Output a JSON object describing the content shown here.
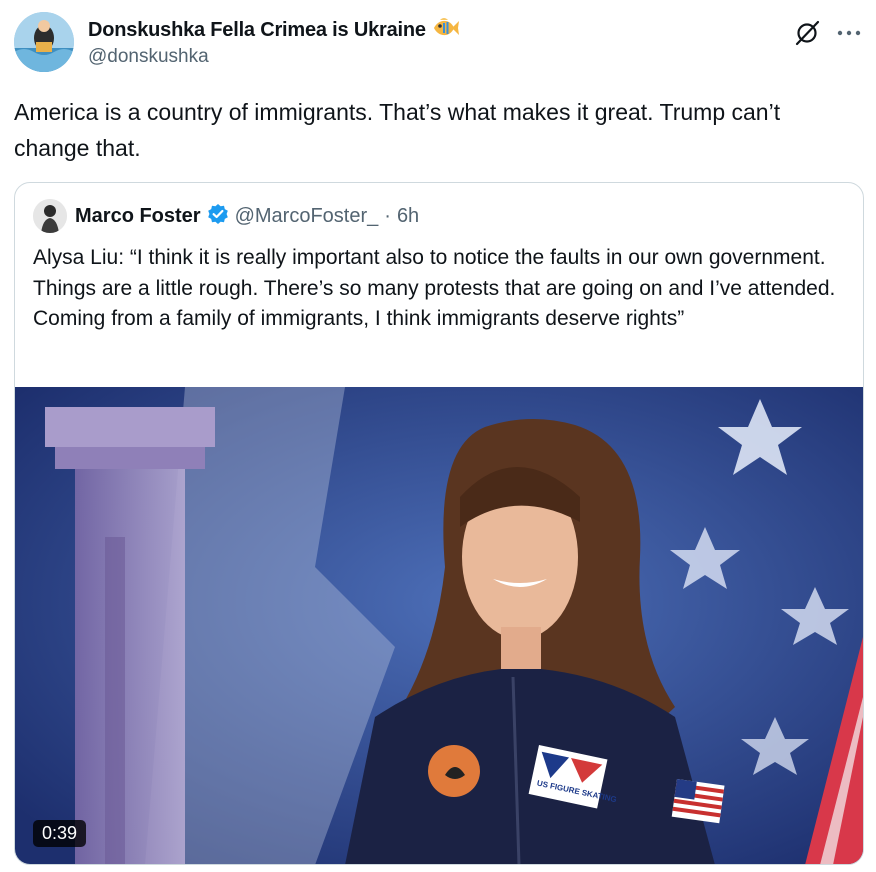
{
  "author": {
    "display_name": "Donskushka Fella Crimea is Ukraine",
    "handle": "@donskushka",
    "name_emoji_icon": "fish-icon"
  },
  "post": {
    "text": "America is a country of immigrants. That’s what makes it great. Trump can’t change that."
  },
  "header_icons": [
    "grok-icon",
    "more-icon"
  ],
  "quoted_post": {
    "display_name": "Marco Foster",
    "verified": true,
    "handle": "@MarcoFoster_",
    "separator": "·",
    "time": "6h",
    "text": "Alysa Liu: “I think it is really important also to notice the faults in our own government. Things are a little rough. There’s so many protests that are going on and I’ve attended. Coming from a family of immigrants, I think immigrants deserve rights”",
    "video": {
      "duration": "0:39",
      "patch_text": "US FIGURE SKATING"
    }
  },
  "colors": {
    "text_primary": "#0f1419",
    "text_secondary": "#536471",
    "border": "#cfd9de",
    "verified_blue": "#1d9bf0"
  }
}
